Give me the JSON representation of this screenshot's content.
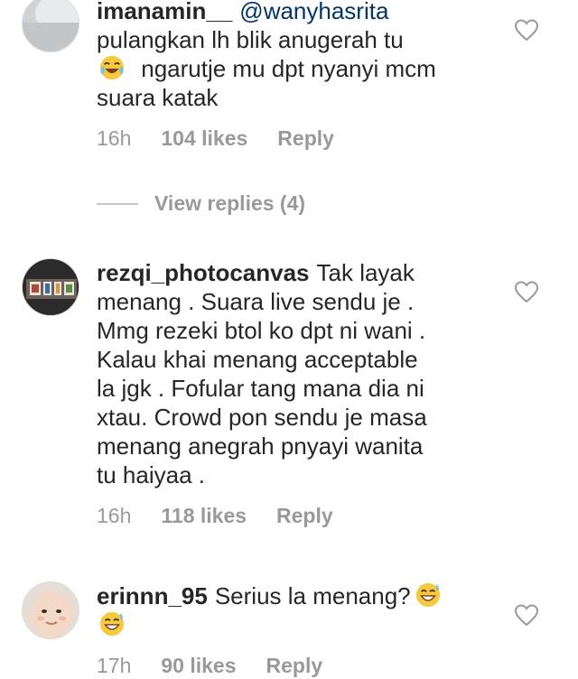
{
  "comments": [
    {
      "username": "imanamin__",
      "mention": "@wanyhasrita",
      "lines": [
        "pulangkan lh blik anugerah tu",
        "ngarutje mu dpt nyanyi mcm",
        "suara katak"
      ],
      "emoji": "tears-of-joy-emoji",
      "time": "16h",
      "likes": "104 likes",
      "reply": "Reply"
    },
    {
      "username": "rezqi_photocanvas",
      "lines": [
        "Tak layak",
        "menang . Suara live sendu je .",
        "Mmg rezeki btol ko dpt ni wani .",
        "Kalau khai menang acceptable",
        "la jgk . Fofular tang mana dia ni",
        "xtau. Crowd pon sendu je masa",
        "menang anegrah pnyayi wanita",
        "tu haiyaa ."
      ],
      "time": "16h",
      "likes": "118 likes",
      "reply": "Reply"
    },
    {
      "username": "erinnn_95",
      "lines": [
        "Serius la menang?"
      ],
      "emoji": "grinning-sweat-emoji",
      "time": "17h",
      "likes": "90 likes",
      "reply": "Reply"
    }
  ],
  "view_replies": "View replies (4)",
  "colors": {
    "text": "#262626",
    "meta": "#999999",
    "mention": "#003569"
  }
}
